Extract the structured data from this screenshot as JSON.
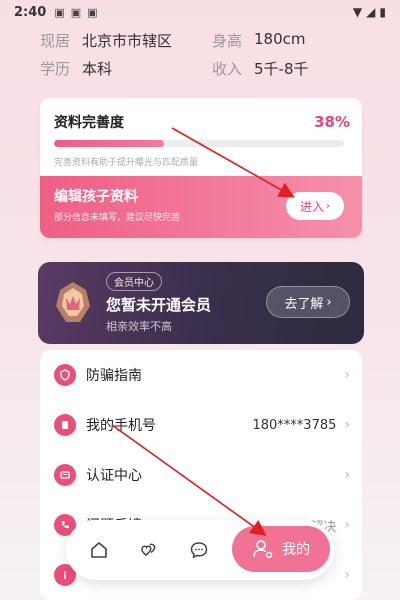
{
  "status_bar": {
    "time": "2:40",
    "icons": [
      "image-icon",
      "a-icon",
      "briefcase-icon"
    ],
    "right_icons": [
      "wifi-icon",
      "signal-icon",
      "battery-icon"
    ]
  },
  "info": {
    "residence_label": "现居",
    "residence_value": "北京市市辖区",
    "height_label": "身高",
    "height_value": "180cm",
    "education_label": "学历",
    "education_value": "本科",
    "income_label": "收入",
    "income_value": "5千-8千"
  },
  "profile": {
    "title": "资料完善度",
    "percent_text": "38%",
    "percent": 0.38,
    "hint": "完善资料有助于提升曝光与匹配质量",
    "edit_title": "编辑孩子资料",
    "edit_sub": "部分信息未填写，建议尽快完善",
    "enter_label": "进入"
  },
  "vip": {
    "tag": "会员中心",
    "title": "您暂未开通会员",
    "sub": "相亲效率不高",
    "button_label": "去了解"
  },
  "menu": [
    {
      "label": "防骗指南",
      "value": "",
      "icon": "shield-icon"
    },
    {
      "label": "我的手机号",
      "value": "180****3785",
      "icon": "phone-book-icon"
    },
    {
      "label": "认证中心",
      "value": "",
      "icon": "id-card-icon"
    },
    {
      "label": "问题反馈",
      "value": "任何问题 全力解决",
      "icon": "handset-icon"
    },
    {
      "label": "",
      "value": "",
      "icon": "info-icon"
    }
  ],
  "nav": {
    "items": [
      "home-icon",
      "hearts-icon",
      "chat-icon"
    ],
    "active_label": "我的"
  },
  "colors": {
    "accent": "#ea4f7c",
    "vip_bg": "#3a2f4d",
    "annotation": "#e02020"
  }
}
